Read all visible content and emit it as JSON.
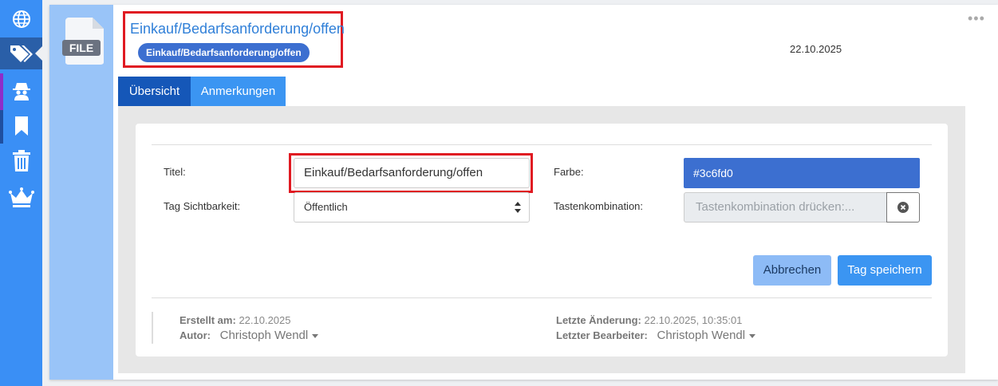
{
  "header": {
    "title": "Einkauf/Bedarfsanforderung/offen",
    "badge": "Einkauf/Bedarfsanforderung/offen",
    "date": "22.10.2025",
    "more": "•••"
  },
  "file_icon_label": "FILE",
  "tabs": [
    {
      "label": "Übersicht",
      "active": true
    },
    {
      "label": "Anmerkungen",
      "active": false
    }
  ],
  "form": {
    "title_label": "Titel:",
    "title_value": "Einkauf/Bedarfsanforderung/offen",
    "color_label": "Farbe:",
    "color_value": "#3c6fd0",
    "visibility_label": "Tag Sichtbarkeit:",
    "visibility_value": "Öffentlich",
    "shortcut_label": "Tastenkombination:",
    "shortcut_placeholder": "Tastenkombination drücken:..."
  },
  "buttons": {
    "cancel": "Abbrechen",
    "save": "Tag speichern"
  },
  "meta": {
    "created_label": "Erstellt am:",
    "created_value": "22.10.2025",
    "author_label": "Autor:",
    "author_value": "Christoph Wendl",
    "changed_label": "Letzte Änderung:",
    "changed_value": "22.10.2025, 10:35:01",
    "editor_label": "Letzter Bearbeiter:",
    "editor_value": "Christoph Wendl"
  },
  "sidebar_icons": [
    "globe-icon",
    "tags-icon",
    "spy-icon",
    "bookmark-icon",
    "trash-icon",
    "crown-icon"
  ],
  "colors": {
    "sidebar": "#3a8ff5",
    "accent": "#3c6fd0",
    "highlight": "#e01a22"
  }
}
